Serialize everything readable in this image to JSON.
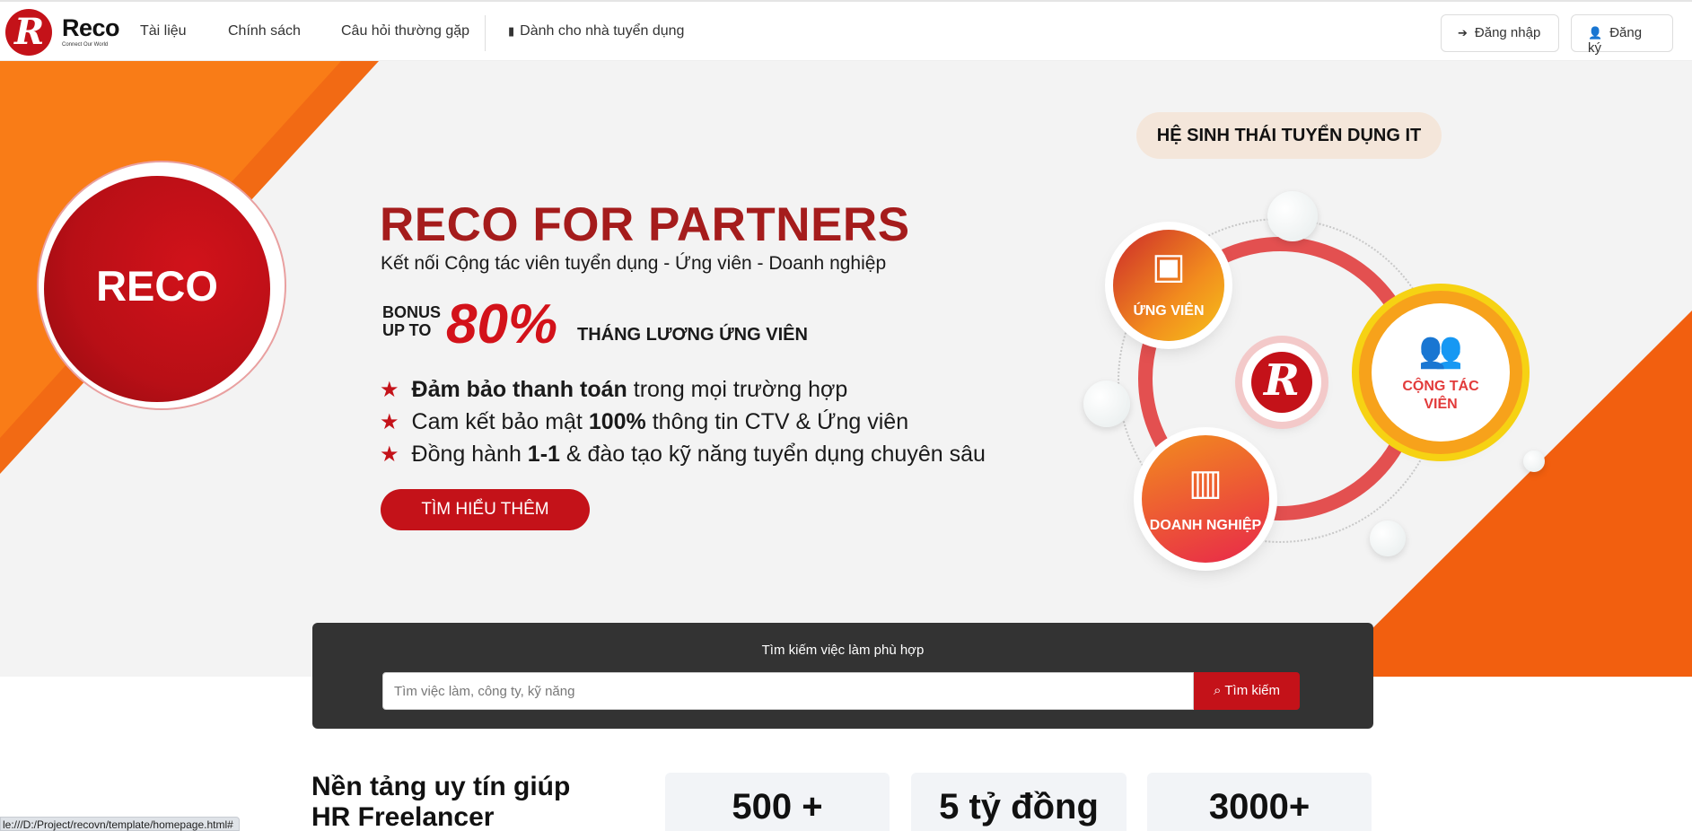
{
  "nav": {
    "brand": "Reco",
    "tagline": "Connect Our World",
    "links": [
      "Tài liệu",
      "Chính sách",
      "Câu hỏi thường gặp"
    ],
    "employer_link": "Dành cho nhà tuyển dụng",
    "login": "Đăng nhập",
    "register": "Đăng ký"
  },
  "hero": {
    "reco_badge": "RECO",
    "title": "RECO FOR PARTNERS",
    "subtitle": "Kết nối Cộng tác viên tuyển dụng - Ứng viên - Doanh nghiệp",
    "bonus_label_1": "BONUS",
    "bonus_label_2": "UP TO",
    "bonus_percent": "80%",
    "bonus_text": "THÁNG LƯƠNG ỨNG VIÊN",
    "bullets": [
      {
        "bold": "Đảm bảo thanh toán",
        "rest": " trong mọi trường hợp"
      },
      {
        "pre": "Cam kết bảo mật ",
        "bold": "100%",
        "rest": " thông tin CTV & Ứng viên"
      },
      {
        "pre": "Đồng hành ",
        "bold": "1-1",
        "rest": " & đào tạo kỹ năng tuyển dụng chuyên sâu"
      }
    ],
    "cta": "TÌM HIỂU THÊM",
    "ecosystem_badge": "HỆ SINH THÁI TUYỂN DỤNG IT",
    "nodes": {
      "candidate": "ỨNG VIÊN",
      "collaborator_1": "CỘNG TÁC",
      "collaborator_2": "VIÊN",
      "business": "DOANH NGHIỆP"
    }
  },
  "search": {
    "title": "Tìm kiếm việc làm phù hợp",
    "placeholder": "Tìm việc làm, công ty, kỹ năng",
    "button": "Tìm kiếm"
  },
  "stats": {
    "heading_1": "Nền tảng uy tín giúp",
    "heading_2": "HR Freelancer",
    "items": [
      "500 +",
      "5 tỷ đồng",
      "3000+"
    ]
  },
  "status_bar": "le:///D:/Project/recovn/template/homepage.html#",
  "colors": {
    "brand_red": "#c41219",
    "orange": "#f26a14",
    "dark_panel": "#333333"
  }
}
